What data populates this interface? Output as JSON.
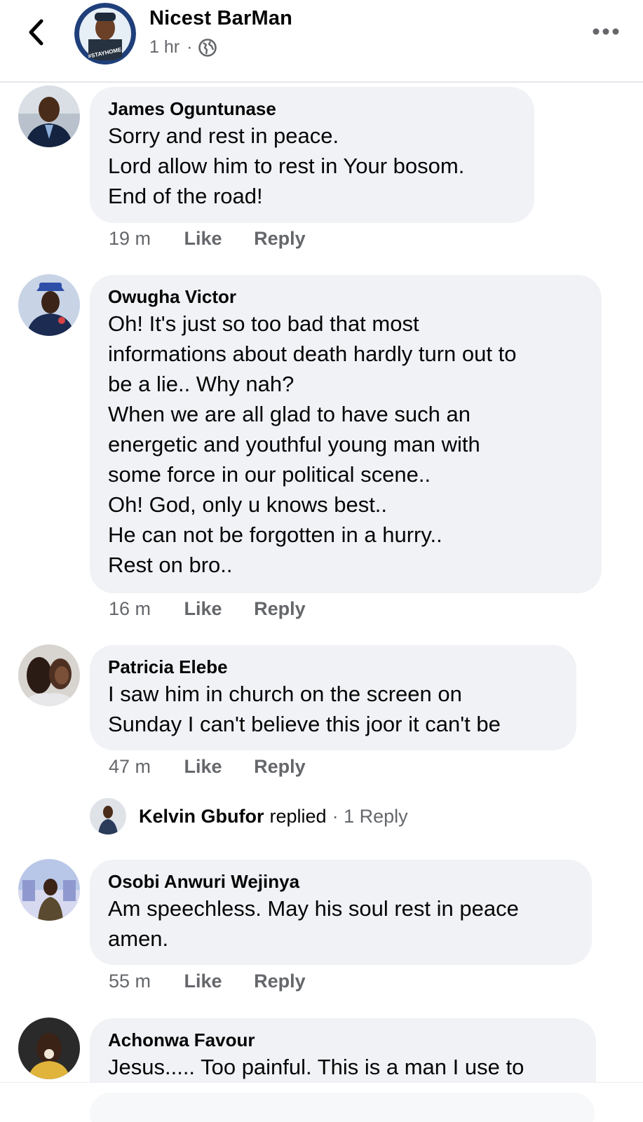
{
  "header": {
    "back_icon": "chevron-left-icon",
    "name": "Nicest BarMan",
    "time": "1 hr",
    "separator": "·",
    "privacy_icon": "globe-icon",
    "more_icon": "more-horizontal-icon",
    "avatar_badge": "#STAYHOME"
  },
  "comments": [
    {
      "author": "James Oguntunase",
      "text": "Sorry and rest in peace.\nLord allow him to rest in Your bosom.\nEnd of the road!",
      "time": "19 m",
      "like": "Like",
      "reply": "Reply"
    },
    {
      "author": "Owugha Victor",
      "text": "Oh! It's just so too bad that most\ninformations about death hardly turn out to\nbe a lie.. Why nah?\nWhen we are all glad to have such an\nenergetic and youthful young man with\nsome force in our political scene..\nOh! God, only u knows best..\nHe can not be forgotten in a hurry..\nRest on bro..",
      "time": "16 m",
      "like": "Like",
      "reply": "Reply"
    },
    {
      "author": "Patricia Elebe",
      "text": "I saw him in church on the screen on\nSunday I can't believe this joor it can't be",
      "time": "47 m",
      "like": "Like",
      "reply": "Reply",
      "replies": {
        "name": "Kelvin Gbufor",
        "verb": "replied",
        "count": "· 1 Reply"
      }
    },
    {
      "author": "Osobi Anwuri Wejinya",
      "text": "Am speechless. May his soul rest in peace\namen.",
      "time": "55 m",
      "like": "Like",
      "reply": "Reply"
    },
    {
      "author": "Achonwa Favour",
      "text": "Jesus..... Too painful. This is a man I use to"
    }
  ],
  "colors": {
    "bubble": "#f0f2f5",
    "meta_text": "#65676b",
    "primary_text": "#050505"
  }
}
